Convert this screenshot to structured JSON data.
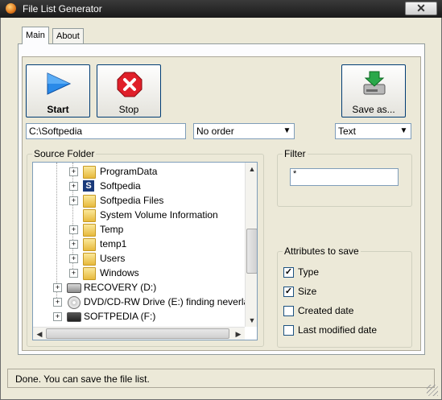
{
  "window": {
    "title": "File List Generator",
    "close_glyph": "✕"
  },
  "tabs": [
    {
      "label": "Main"
    },
    {
      "label": "About"
    }
  ],
  "toolbar": {
    "start_label": "Start",
    "stop_label": "Stop",
    "save_label": "Save as..."
  },
  "path_field": {
    "value": "C:\\Softpedia"
  },
  "order_select": {
    "value": "No order"
  },
  "format_select": {
    "value": "Text"
  },
  "source_folder": {
    "legend": "Source Folder",
    "items": [
      {
        "label": "ProgramData",
        "icon": "folder-icon"
      },
      {
        "label": "Softpedia",
        "icon": "softpedia-icon"
      },
      {
        "label": "Softpedia Files",
        "icon": "folder-icon"
      },
      {
        "label": "System Volume Information",
        "icon": "folder-icon"
      },
      {
        "label": "Temp",
        "icon": "folder-icon"
      },
      {
        "label": "temp1",
        "icon": "folder-icon"
      },
      {
        "label": "Users",
        "icon": "folder-icon"
      },
      {
        "label": "Windows",
        "icon": "folder-icon"
      },
      {
        "label": "RECOVERY (D:)",
        "icon": "drive-icon"
      },
      {
        "label": "DVD/CD-RW Drive (E:) finding neverland",
        "icon": "cd-icon"
      },
      {
        "label": "SOFTPEDIA (F:)",
        "icon": "drive-icon"
      }
    ]
  },
  "filter": {
    "legend": "Filter",
    "value": "*"
  },
  "attributes": {
    "legend": "Attributes to save",
    "items": [
      {
        "label": "Type",
        "checked": true
      },
      {
        "label": "Size",
        "checked": true
      },
      {
        "label": "Created date",
        "checked": false
      },
      {
        "label": "Last modified date",
        "checked": false
      }
    ]
  },
  "status": {
    "text": "Done.  You can save the file list."
  },
  "colors": {
    "title_bar": "#2a2a2a",
    "window_bg": "#ece9d8",
    "start_icon": "#2a8ae8",
    "stop_icon": "#e0202a",
    "save_icon": "#2aa84a"
  }
}
